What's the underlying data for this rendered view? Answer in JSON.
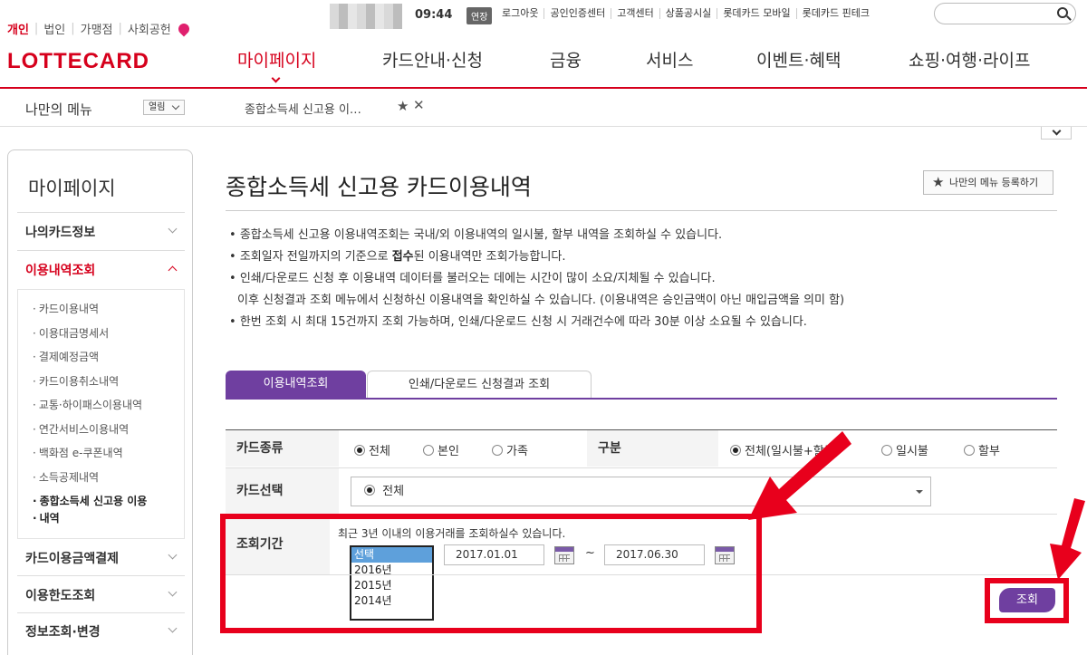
{
  "topbar": {
    "segments": [
      "개인",
      "법인",
      "가맹점",
      "사회공헌"
    ],
    "time": "09:44",
    "extend_label": "연장",
    "links": [
      "로그아웃",
      "공인인증센터",
      "고객센터",
      "상품공시실",
      "롯데카드 모바일",
      "롯데카드 핀테크"
    ]
  },
  "logo": "LOTTECARD",
  "gnb": [
    "마이페이지",
    "카드안내·신청",
    "금융",
    "서비스",
    "이벤트·혜택",
    "쇼핑·여행·라이프"
  ],
  "mymenu": {
    "title": "나만의 메뉴",
    "open_label": "열림",
    "recent_item": "종합소득세 신고용 이…"
  },
  "sidebar": {
    "title": "마이페이지",
    "groups": [
      "나의카드정보",
      "이용내역조회",
      "카드이용금액결제",
      "이용한도조회",
      "정보조회·변경"
    ],
    "sub_items": [
      "카드이용내역",
      "이용대금명세서",
      "결제예정금액",
      "카드이용취소내역",
      "교통·하이패스이용내역",
      "연간서비스이용내역",
      "백화점 e-쿠폰내역",
      "소득공제내역",
      "종합소득세 신고용 이용",
      "내역"
    ]
  },
  "page": {
    "title": "종합소득세 신고용 카드이용내역",
    "register_label": "나만의 메뉴 등록하기",
    "info": [
      "종합소득세 신고용 이용내역조회는 국내/외 이용내역의 일시불, 할부 내역을 조회하실 수 있습니다.",
      "조회일자 전일까지의 기준으로",
      "접수",
      "된 이용내역만 조회가능합니다.",
      "인쇄/다운로드 신청 후 이용내역 데이터를 불러오는 데에는 시간이 많이 소요/지체될 수 있습니다.",
      "이후 신청결과 조회 메뉴에서 신청하신 이용내역을 확인하실 수 있습니다. (이용내역은 승인금액이 아닌 매입금액을 의미 함)",
      "한번 조회 시 최대 15건까지 조회 가능하며, 인쇄/다운로드 신청 시 거래건수에 따라 30분 이상 소요될 수 있습니다."
    ],
    "tabs": [
      "이용내역조회",
      "인쇄/다운로드 신청결과 조회"
    ]
  },
  "form": {
    "card_type_label": "카드종류",
    "card_type_options": [
      "전체",
      "본인",
      "가족"
    ],
    "category_label": "구분",
    "category_options": [
      "전체(일시불+할부)",
      "일시불",
      "할부"
    ],
    "card_select_label": "카드선택",
    "card_select_value": "전체",
    "period_label": "조회기간",
    "period_note": "최근 3년 이내의 이용거래를 조회하실수 있습니다.",
    "year_options": [
      "선택",
      "2016년",
      "2015년",
      "2014년"
    ],
    "start_date": "2017.01.01",
    "end_date": "2017.06.30",
    "tilde": "~",
    "search_label": "조회"
  },
  "colors": {
    "brand": "#d6001c",
    "accent": "#6f3fa0",
    "annotation": "#e8001c"
  }
}
